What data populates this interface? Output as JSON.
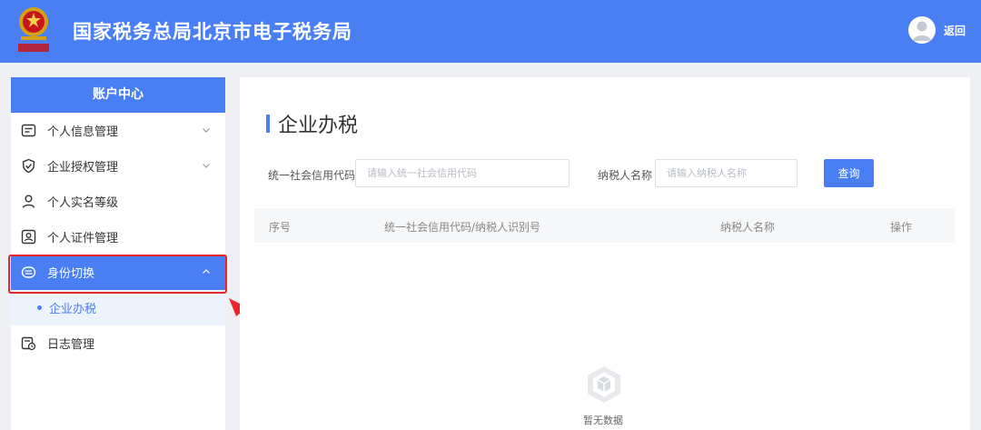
{
  "header": {
    "title": "国家税务总局北京市电子税务局",
    "back_label": "返回",
    "logo_icon": "tax-emblem-icon",
    "avatar_icon": "user-avatar-icon"
  },
  "sidebar": {
    "title": "账户中心",
    "items": [
      {
        "label": "个人信息管理",
        "icon": "profile-card-icon",
        "expandable": true,
        "expanded": false
      },
      {
        "label": "企业授权管理",
        "icon": "shield-check-icon",
        "expandable": true,
        "expanded": false
      },
      {
        "label": "个人实名等级",
        "icon": "user-level-icon",
        "expandable": false
      },
      {
        "label": "个人证件管理",
        "icon": "id-card-icon",
        "expandable": false
      },
      {
        "label": "身份切换",
        "icon": "switch-identity-icon",
        "expandable": true,
        "expanded": true,
        "active": true
      },
      {
        "label": "日志管理",
        "icon": "calendar-log-icon",
        "expandable": false
      }
    ],
    "sub_items": [
      {
        "label": "企业办税",
        "selected": true
      }
    ]
  },
  "main": {
    "title": "企业办税",
    "search": {
      "credit_code_label": "统一社会信用代码",
      "credit_code_placeholder": "请输入统一社会信用代码",
      "taxpayer_name_label": "纳税人名称",
      "taxpayer_name_placeholder": "请输入纳税人名称",
      "query_label": "查询"
    },
    "table": {
      "columns": [
        "序号",
        "统一社会信用代码/纳税人识别号",
        "纳税人名称",
        "操作"
      ],
      "rows": []
    },
    "empty_text": "暂无数据"
  },
  "colors": {
    "brand": "#4a7ff3",
    "highlight": "#e8262a",
    "sub_item_bg": "#edf3fd"
  }
}
